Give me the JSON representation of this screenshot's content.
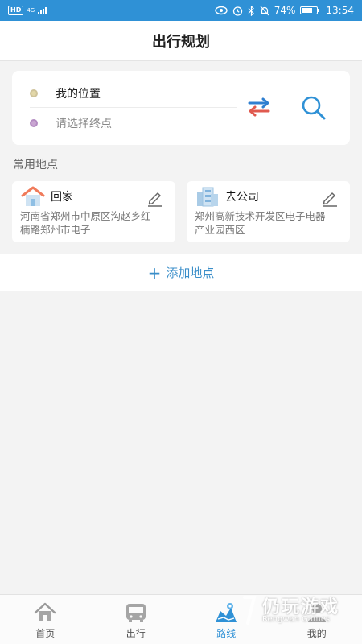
{
  "status_bar": {
    "network_badge": "HD",
    "network_type": "4G",
    "battery_percent": "74%",
    "battery_level": 0.74,
    "time": "13:54"
  },
  "header": {
    "title": "出行规划"
  },
  "route": {
    "from_label": "我的位置",
    "to_placeholder": "请选择终点"
  },
  "frequent_places": {
    "section_title": "常用地点",
    "items": [
      {
        "name": "回家",
        "address": "河南省郑州市中原区沟赵乡红楠路郑州市电子",
        "icon": "house-icon"
      },
      {
        "name": "去公司",
        "address": "郑州高新技术开发区电子电器产业园西区",
        "icon": "office-building-icon"
      }
    ],
    "add_label": "添加地点"
  },
  "tabbar": {
    "tabs": [
      {
        "label": "首页",
        "icon": "home-icon"
      },
      {
        "label": "出行",
        "icon": "bus-icon"
      },
      {
        "label": "路线",
        "icon": "route-map-icon",
        "active": true
      },
      {
        "label": "我的",
        "icon": "user-icon"
      }
    ]
  },
  "watermark": {
    "text": "仍玩游戏",
    "sub": "Rengwan Games"
  },
  "colors": {
    "accent": "#2f91d6",
    "link": "#3a8ec9",
    "swap_blue": "#2f7fd0",
    "swap_red": "#e05a4f"
  }
}
